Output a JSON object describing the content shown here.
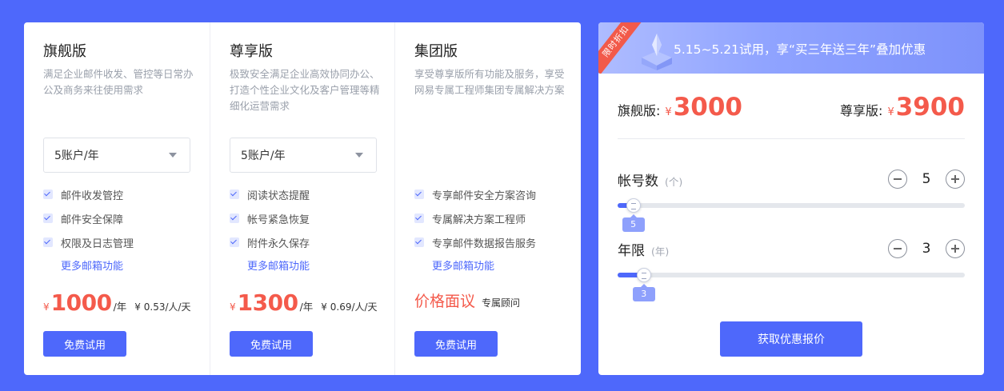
{
  "plans": [
    {
      "name": "旗舰版",
      "desc": "满足企业邮件收发、管控等日常办公及商务来往使用需求",
      "select_value": "5账户/年",
      "features": [
        "邮件收发管控",
        "邮件安全保障",
        "权限及日志管理"
      ],
      "more_link": "更多邮箱功能",
      "currency": "¥",
      "price": "1000",
      "per": "/年",
      "unit_price": "¥ 0.53/人/天",
      "trial_button": "免费试用"
    },
    {
      "name": "尊享版",
      "desc": "极致安全满足企业高效协同办公、打造个性企业文化及客户管理等精细化运营需求",
      "select_value": "5账户/年",
      "features": [
        "阅读状态提醒",
        "帐号紧急恢复",
        "附件永久保存"
      ],
      "more_link": "更多邮箱功能",
      "currency": "¥",
      "price": "1300",
      "per": "/年",
      "unit_price": "¥ 0.69/人/天",
      "trial_button": "免费试用"
    },
    {
      "name": "集团版",
      "desc": "享受尊享版所有功能及服务，享受网易专属工程师集团专属解决方案",
      "features": [
        "专享邮件安全方案咨询",
        "专属解决方案工程师",
        "专享邮件数据报告服务"
      ],
      "more_link": "更多邮箱功能",
      "price_text": "价格面议",
      "consultant": "专属顾问",
      "trial_button": "免费试用"
    }
  ],
  "promo": {
    "ribbon": "限时折扣",
    "banner_text": "5.15~5.21试用，享“买三年送三年”叠加优惠",
    "quote_1": {
      "label": "旗舰版:",
      "currency": "¥",
      "amount": "3000"
    },
    "quote_2": {
      "label": "尊享版:",
      "currency": "¥",
      "amount": "3900"
    },
    "accounts": {
      "label": "帐号数",
      "unit": "(个)",
      "value": "5",
      "tip": "5",
      "level": 0.02
    },
    "years": {
      "label": "年限",
      "unit": "(年)",
      "value": "3",
      "tip": "3",
      "level": 0.05
    },
    "quote_button": "获取优惠报价"
  },
  "colors": {
    "background": "#4e68fb",
    "accent": "#4e68fb",
    "price_red": "#f45a4b"
  }
}
